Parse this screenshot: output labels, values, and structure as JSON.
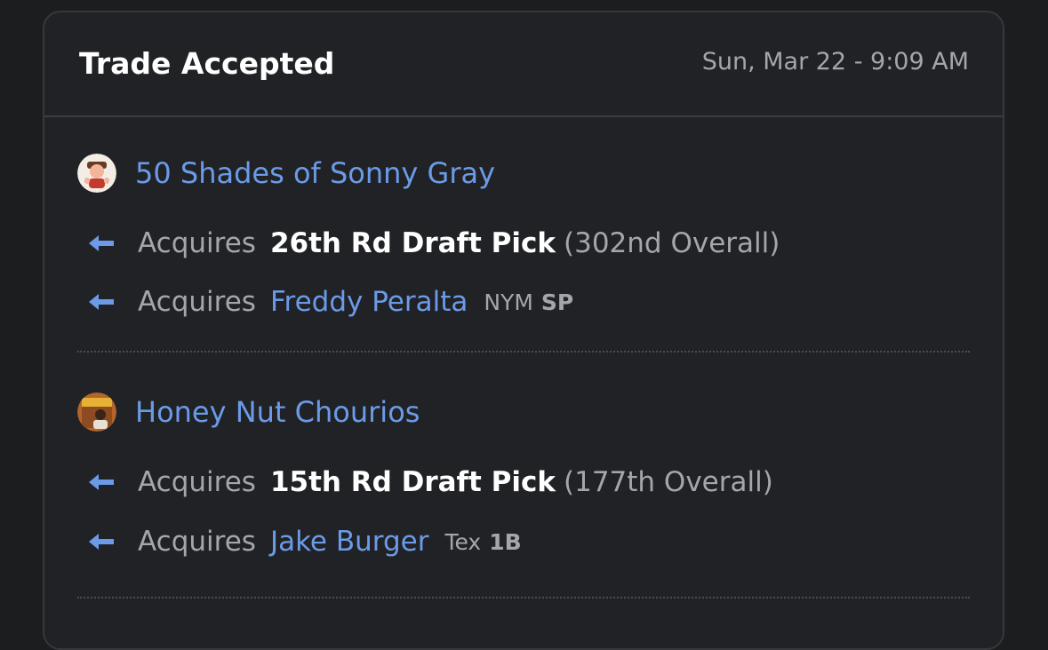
{
  "header": {
    "title": "Trade Accepted",
    "timestamp": "Sun, Mar 22 - 9:09 AM"
  },
  "teams": [
    {
      "name": "50 Shades of Sonny Gray",
      "avatar": "team-avatar-cartoon",
      "acquisitions": [
        {
          "label": "Acquires",
          "item": "26th Rd Draft Pick",
          "detail": "(302nd Overall)"
        },
        {
          "label": "Acquires",
          "player": "Freddy Peralta",
          "team": "NYM",
          "position": "SP"
        }
      ]
    },
    {
      "name": "Honey Nut Chourios",
      "avatar": "team-avatar-cereal-box",
      "acquisitions": [
        {
          "label": "Acquires",
          "item": "15th Rd Draft Pick",
          "detail": "(177th Overall)"
        },
        {
          "label": "Acquires",
          "player": "Jake Burger",
          "team": "Tex",
          "position": "1B"
        }
      ]
    }
  ],
  "colors": {
    "background": "#1c1d1f",
    "card": "#212225",
    "link": "#6b9be8",
    "muted": "#a4a6aa",
    "text": "#ffffff"
  },
  "icons": {
    "arrow": "arrow-left-icon"
  }
}
